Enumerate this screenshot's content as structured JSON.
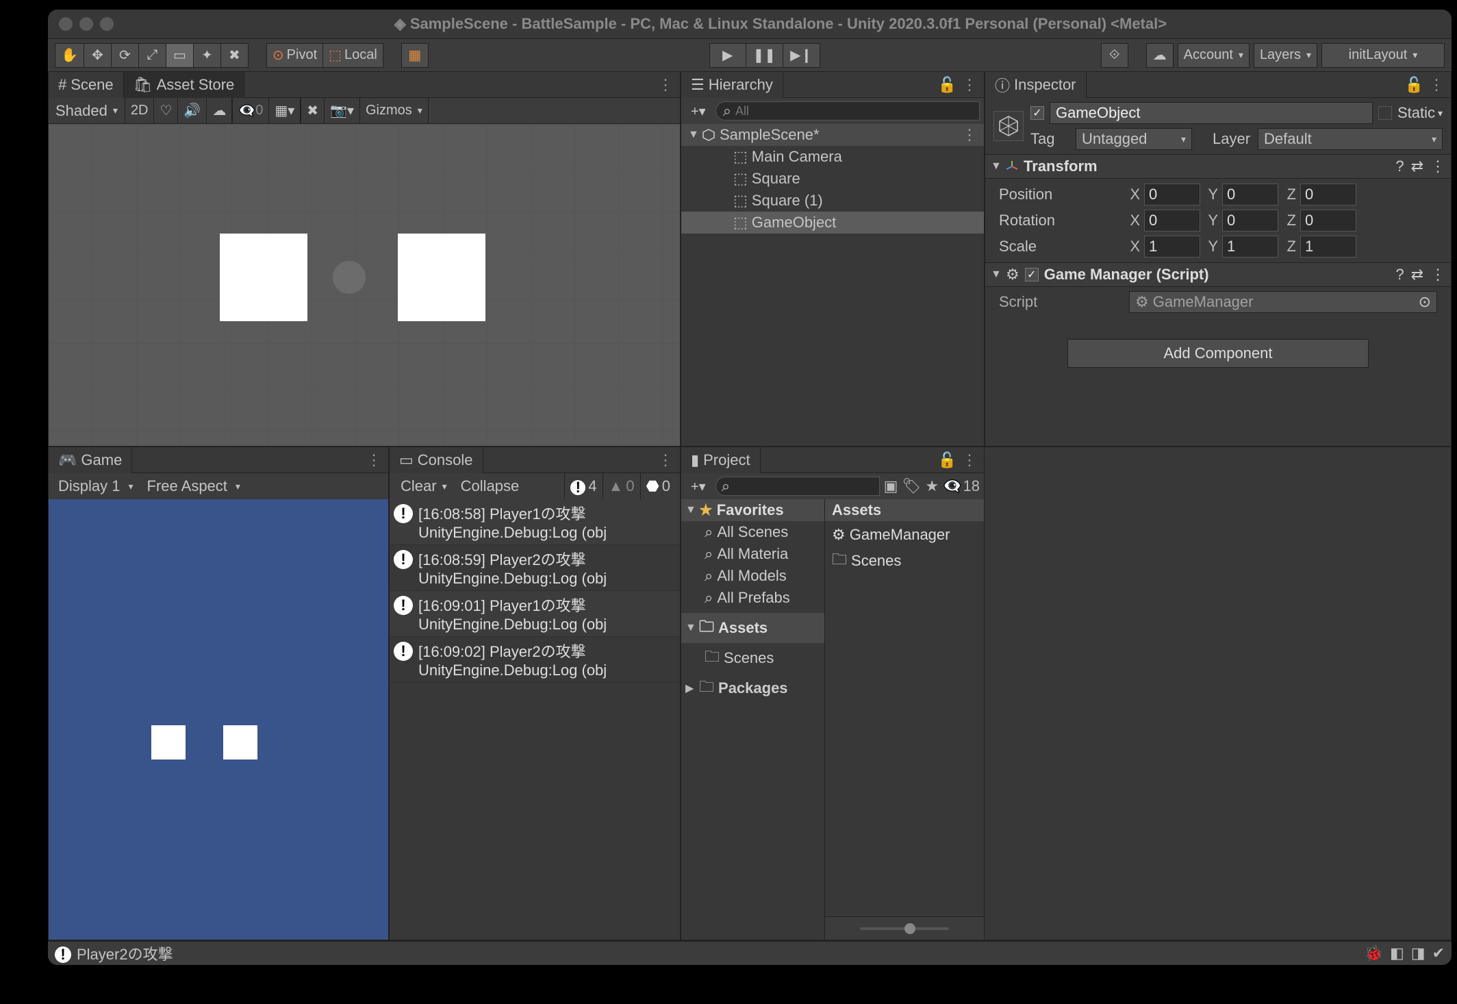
{
  "title": "SampleScene - BattleSample - PC, Mac & Linux Standalone - Unity 2020.3.0f1 Personal (Personal) <Metal>",
  "toolbar": {
    "pivot": "Pivot",
    "local": "Local",
    "account": "Account",
    "layers": "Layers",
    "layout": "initLayout"
  },
  "scene": {
    "tabs": {
      "scene": "Scene",
      "assetstore": "Asset Store"
    },
    "shading": "Shaded",
    "2d": "2D",
    "gizmo_number": "0",
    "gizmos": "Gizmos"
  },
  "hierarchy": {
    "title": "Hierarchy",
    "search_placeholder": "All",
    "scene_name": "SampleScene*",
    "items": [
      {
        "name": "Main Camera"
      },
      {
        "name": "Square"
      },
      {
        "name": "Square (1)"
      },
      {
        "name": "GameObject"
      }
    ]
  },
  "inspector": {
    "title": "Inspector",
    "go_name": "GameObject",
    "static": "Static",
    "tag_label": "Tag",
    "tag_value": "Untagged",
    "layer_label": "Layer",
    "layer_value": "Default",
    "transform": {
      "title": "Transform",
      "rows": [
        {
          "prop": "Position",
          "x": "0",
          "y": "0",
          "z": "0"
        },
        {
          "prop": "Rotation",
          "x": "0",
          "y": "0",
          "z": "0"
        },
        {
          "prop": "Scale",
          "x": "1",
          "y": "1",
          "z": "1"
        }
      ]
    },
    "component": {
      "title": "Game Manager (Script)",
      "script_label": "Script",
      "script_value": "GameManager"
    },
    "add_component": "Add Component"
  },
  "game": {
    "title": "Game",
    "display": "Display 1",
    "aspect": "Free Aspect"
  },
  "console": {
    "title": "Console",
    "clear": "Clear",
    "collapse": "Collapse",
    "info_count": "4",
    "warn_count": "0",
    "err_count": "0",
    "logs": [
      {
        "line1": "[16:08:58] Player1の攻撃",
        "line2": "UnityEngine.Debug:Log (obj"
      },
      {
        "line1": "[16:08:59] Player2の攻撃",
        "line2": "UnityEngine.Debug:Log (obj"
      },
      {
        "line1": "[16:09:01] Player1の攻撃",
        "line2": "UnityEngine.Debug:Log (obj"
      },
      {
        "line1": "[16:09:02] Player2の攻撃",
        "line2": "UnityEngine.Debug:Log (obj"
      }
    ]
  },
  "project": {
    "title": "Project",
    "hidden_count": "18",
    "favorites": "Favorites",
    "fav_items": [
      "All Scenes",
      "All Materia",
      "All Models",
      "All Prefabs"
    ],
    "assets": "Assets",
    "assets_children": [
      "Scenes"
    ],
    "packages": "Packages",
    "crumb": "Assets",
    "items": [
      {
        "icon": "gear",
        "name": "GameManager"
      },
      {
        "icon": "folder",
        "name": "Scenes"
      }
    ]
  },
  "statusbar": {
    "text": "Player2の攻撃"
  }
}
